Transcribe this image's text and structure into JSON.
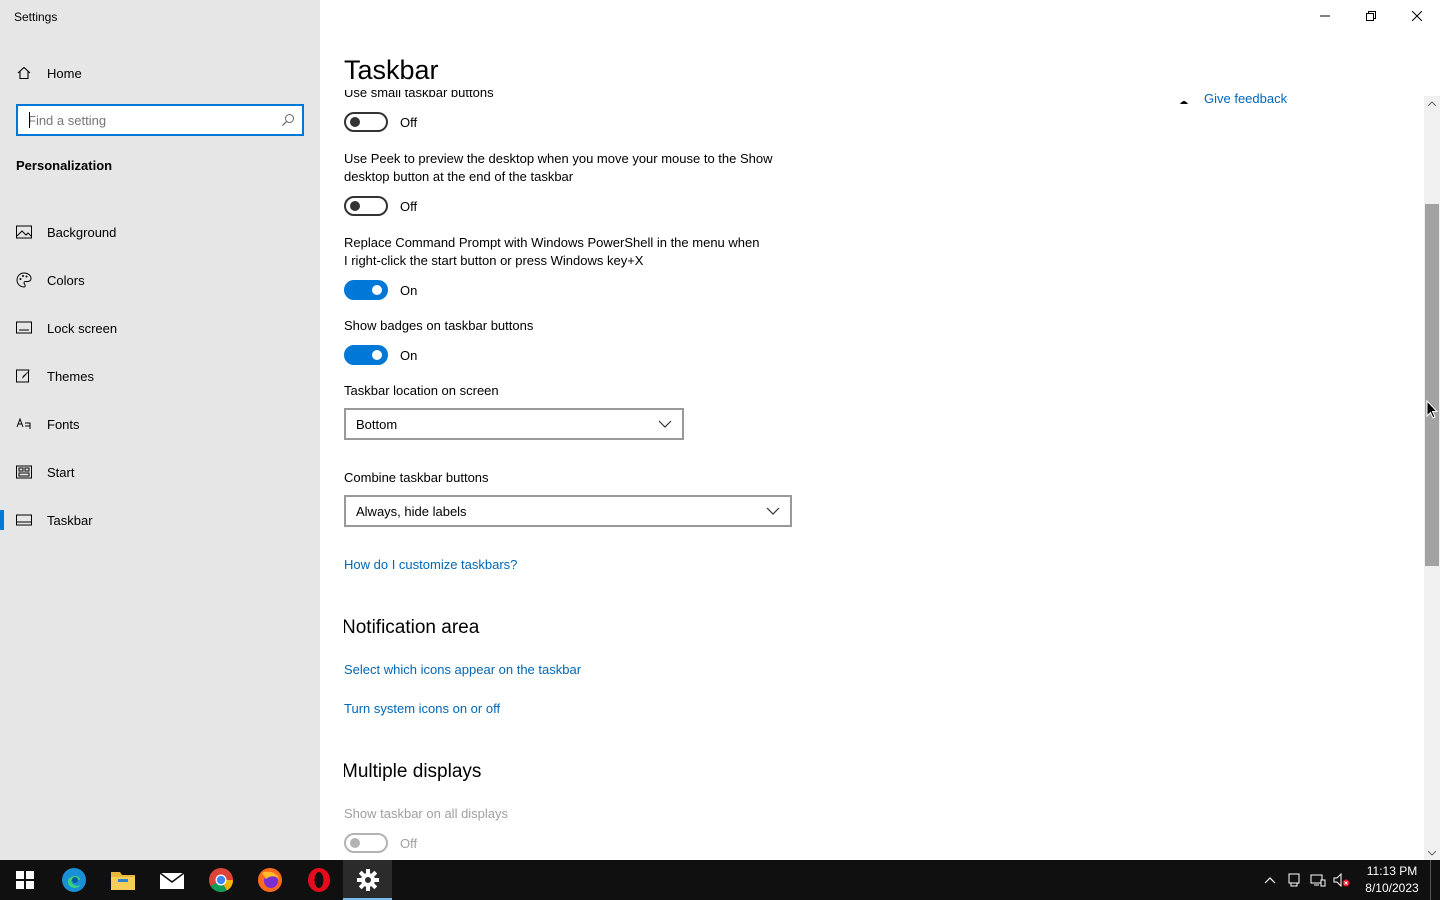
{
  "window": {
    "title": "Settings"
  },
  "sidebar": {
    "home_label": "Home",
    "search_placeholder": "Find a setting",
    "section": "Personalization",
    "items": [
      {
        "label": "Background",
        "icon": "image-icon"
      },
      {
        "label": "Colors",
        "icon": "palette-icon"
      },
      {
        "label": "Lock screen",
        "icon": "lock-screen-icon"
      },
      {
        "label": "Themes",
        "icon": "brush-icon"
      },
      {
        "label": "Fonts",
        "icon": "font-icon"
      },
      {
        "label": "Start",
        "icon": "start-tiles-icon"
      },
      {
        "label": "Taskbar",
        "icon": "taskbar-icon",
        "active": true
      }
    ]
  },
  "main": {
    "title": "Taskbar",
    "feedback_link": "Give feedback",
    "settings": [
      {
        "label": "Use small taskbar buttons",
        "state": "Off",
        "on": false
      },
      {
        "label": "Use Peek to preview the desktop when you move your mouse to the Show desktop button at the end of the taskbar",
        "state": "Off",
        "on": false
      },
      {
        "label": "Replace Command Prompt with Windows PowerShell in the menu when I right-click the start button or press Windows key+X",
        "state": "On",
        "on": true
      },
      {
        "label": "Show badges on taskbar buttons",
        "state": "On",
        "on": true
      }
    ],
    "location": {
      "label": "Taskbar location on screen",
      "value": "Bottom"
    },
    "combine": {
      "label": "Combine taskbar buttons",
      "value": "Always, hide labels"
    },
    "help_link": "How do I customize taskbars?",
    "notification_area": {
      "heading": "Notification area",
      "link1": "Select which icons appear on the taskbar",
      "link2": "Turn system icons on or off"
    },
    "multiple_displays": {
      "heading": "Multiple displays",
      "label": "Show taskbar on all displays",
      "state": "Off",
      "disabled": true
    }
  },
  "taskbar": {
    "apps": [
      "start-icon",
      "edge-icon",
      "file-explorer-icon",
      "mail-icon",
      "chrome-icon",
      "firefox-icon",
      "opera-icon",
      "settings-gear-icon"
    ],
    "active_app": "settings-gear-icon",
    "clock": {
      "time": "11:13 PM",
      "date": "8/10/2023"
    }
  },
  "colors": {
    "accent": "#0078d7",
    "link": "#0067b8",
    "sidebar_bg": "#e6e6e6",
    "taskbar_bg": "#101010"
  }
}
